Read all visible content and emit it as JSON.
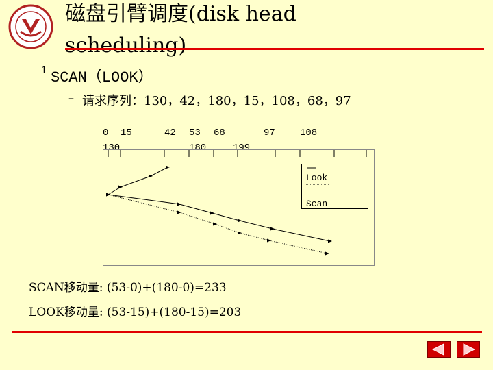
{
  "slide": {
    "title_line1": "磁盘引臂调度(disk head",
    "title_line2": "scheduling)",
    "bullet_number": "1",
    "bullet": "SCAN（LOOK）",
    "sub_marker": "–",
    "sub": "请求序列：130，42，180，15，108，68，97"
  },
  "axis": {
    "row1": [
      "0",
      "15",
      "42",
      "53",
      "68",
      "97",
      "108"
    ],
    "row2": [
      "130",
      "180",
      "199"
    ]
  },
  "legend": {
    "look": "Look",
    "scan": "Scan"
  },
  "calc": {
    "scan": "SCAN移动量: (53-0)+(180-0)=233",
    "look": "LOOK移动量: (53-15)+(180-15)=203"
  },
  "nav": {
    "prev_icon": "prev-arrow-icon",
    "next_icon": "next-arrow-icon"
  },
  "colors": {
    "background": "#FFFFCC",
    "accent": "#E00000"
  },
  "chart_data": {
    "type": "line",
    "head_start": 53,
    "series": [
      {
        "name": "Look",
        "values": [
          53,
          42,
          15,
          68,
          97,
          108,
          130,
          180
        ]
      },
      {
        "name": "Scan",
        "values": [
          53,
          42,
          15,
          0,
          68,
          97,
          108,
          130,
          180
        ]
      }
    ]
  }
}
